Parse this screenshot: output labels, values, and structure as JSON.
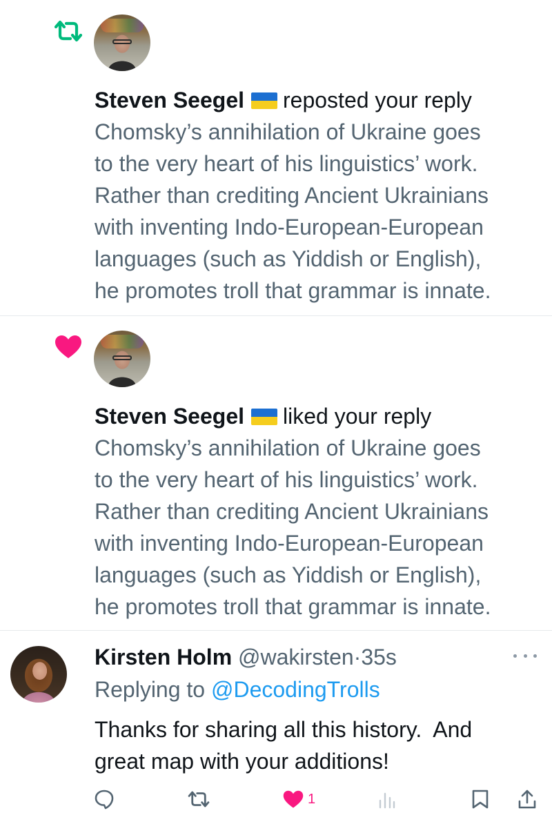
{
  "notifications": [
    {
      "type_icon": "repost-icon",
      "icon_color": "#00ba7c",
      "user_name": "Steven Seegel",
      "flag_icon": "ukraine-flag-icon",
      "action": "reposted your reply",
      "body_lines": [
        "Chomsky’s annihilation of Ukraine goes",
        "to the very heart of his linguistics’ work.",
        "Rather than crediting Ancient Ukrainians",
        "with inventing Indo-European-European",
        "languages (such as Yiddish or English),",
        "he promotes troll that grammar is innate."
      ]
    },
    {
      "type_icon": "heart-icon",
      "icon_color": "#f91880",
      "user_name": "Steven Seegel",
      "flag_icon": "ukraine-flag-icon",
      "action": "liked your reply",
      "body_lines": [
        "Chomsky’s annihilation of Ukraine goes",
        "to the very heart of his linguistics’ work.",
        "Rather than crediting Ancient Ukrainians",
        "with inventing Indo-European-European",
        "languages (such as Yiddish or English),",
        "he promotes troll that grammar is innate."
      ]
    }
  ],
  "reply": {
    "name": "Kirsten Holm",
    "handle": "@wakirsten",
    "separator": "·",
    "time": "35s",
    "replying_prefix": "Replying to",
    "replying_to": "@DecodingTrolls",
    "body_lines": [
      "Thanks for sharing all this history.  And",
      "great map with your additions!"
    ],
    "actions": {
      "reply_icon": "comment-icon",
      "repost_icon": "repost-icon",
      "like_icon": "heart-icon",
      "like_count": "1",
      "views_icon": "analytics-icon",
      "bookmark_icon": "bookmark-icon",
      "share_icon": "share-icon"
    }
  },
  "colors": {
    "text_primary": "#0f1419",
    "text_secondary": "#536471",
    "accent_blue": "#1d9bf0",
    "like_pink": "#f91880",
    "repost_green": "#00ba7c"
  }
}
